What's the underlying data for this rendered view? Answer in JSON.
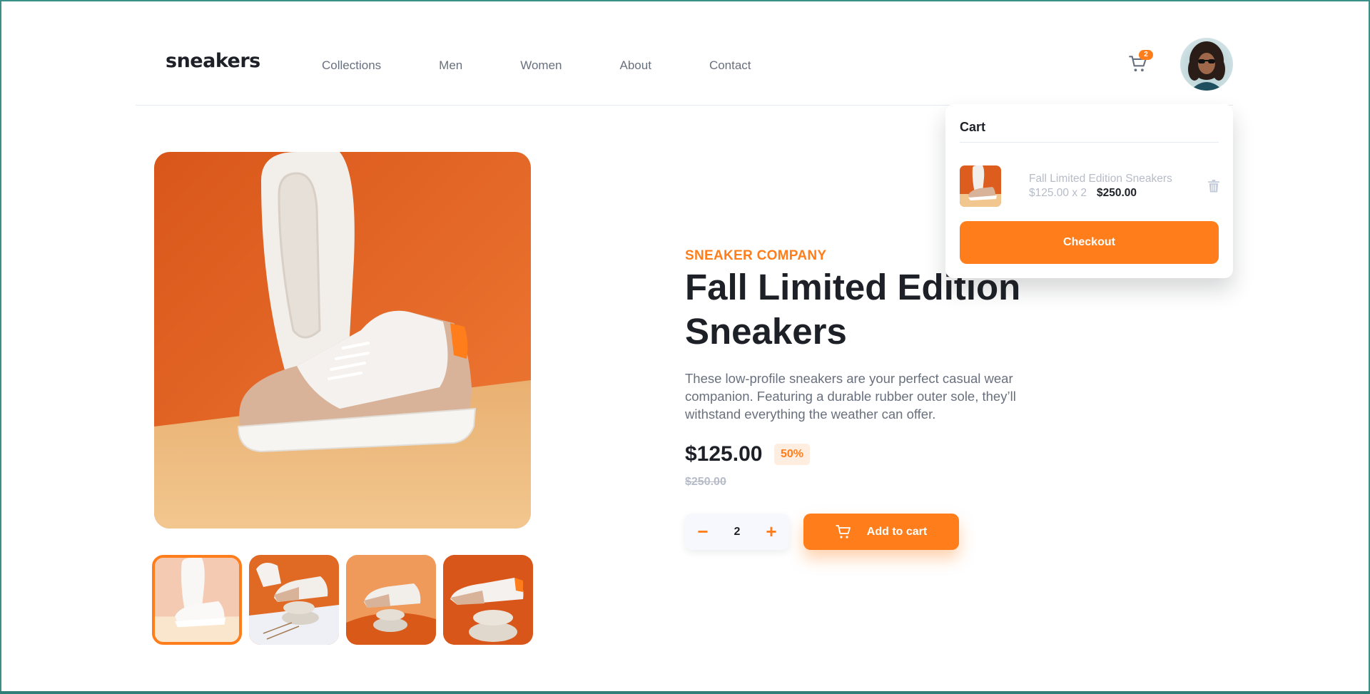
{
  "header": {
    "logo": "sneakers",
    "nav": [
      "Collections",
      "Men",
      "Women",
      "About",
      "Contact"
    ],
    "cart_count": "2"
  },
  "product": {
    "company": "SNEAKER COMPANY",
    "title": "Fall Limited Edition Sneakers",
    "description": "These low-profile sneakers are your perfect casual wear companion. Featuring a durable rubber outer sole, they’ll withstand everything the weather can offer.",
    "price": "$125.00",
    "discount": "50%",
    "old_price": "$250.00",
    "quantity": "2",
    "minus": "−",
    "plus": "+",
    "add_to_cart": "Add to cart"
  },
  "cart": {
    "heading": "Cart",
    "item_name": "Fall Limited Edition Sneakers",
    "item_calc": "$125.00 x 2",
    "item_total": "$250.00",
    "checkout": "Checkout"
  },
  "colors": {
    "accent": "#ff7e1b",
    "accent_pale": "#ffede0",
    "text_dark": "#1d2026",
    "text_grey": "#69707d",
    "text_light": "#b6bcc8"
  },
  "icons": {
    "cart": "cart-icon",
    "trash": "trash-icon",
    "minus": "minus-icon",
    "plus": "plus-icon"
  }
}
